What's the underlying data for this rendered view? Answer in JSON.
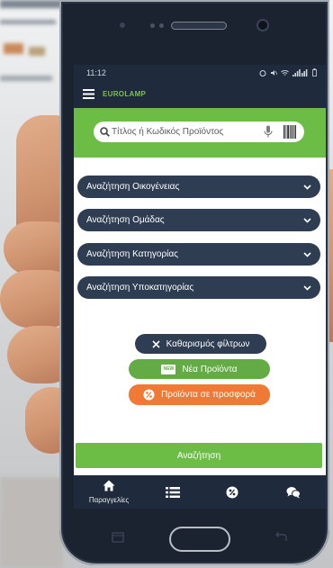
{
  "status_bar": {
    "time": "11:12",
    "icons": [
      "alarm-icon",
      "mute-icon",
      "wifi-icon",
      "signal-icon",
      "battery-icon"
    ]
  },
  "app": {
    "title": "EUROLAMP",
    "menu_icon": "hamburger-menu-icon"
  },
  "search": {
    "placeholder": "Τίτλος ή Κωδικός Προϊόντος",
    "icon": "search-icon",
    "mic_icon": "microphone-icon",
    "barcode_icon": "barcode-icon"
  },
  "filters": [
    {
      "label": "Αναζήτηση Οικογένειας",
      "icon": "chevron-down-icon"
    },
    {
      "label": "Αναζήτηση Ομάδας",
      "icon": "chevron-down-icon"
    },
    {
      "label": "Αναζήτηση Κατηγορίας",
      "icon": "chevron-down-icon"
    },
    {
      "label": "Αναζήτηση Υποκατηγορίας",
      "icon": "chevron-down-icon"
    }
  ],
  "actions": {
    "clear_filters": "Καθαρισμός φίλτρων",
    "new_products": "Νέα Προϊόντα",
    "new_badge": "NEW",
    "offers": "Προϊόντα σε προσφορά"
  },
  "search_button": "Αναζήτηση",
  "bottom_nav": [
    {
      "label": "Παραγγελίες",
      "icon": "home-icon"
    },
    {
      "icon": "list-icon"
    },
    {
      "icon": "percent-icon"
    },
    {
      "icon": "chat-icon"
    }
  ],
  "colors": {
    "primary_dark": "#1f2b3c",
    "pill_dark": "#2e3d52",
    "accent_green": "#6cbd45",
    "offer_orange": "#ee7a36"
  }
}
